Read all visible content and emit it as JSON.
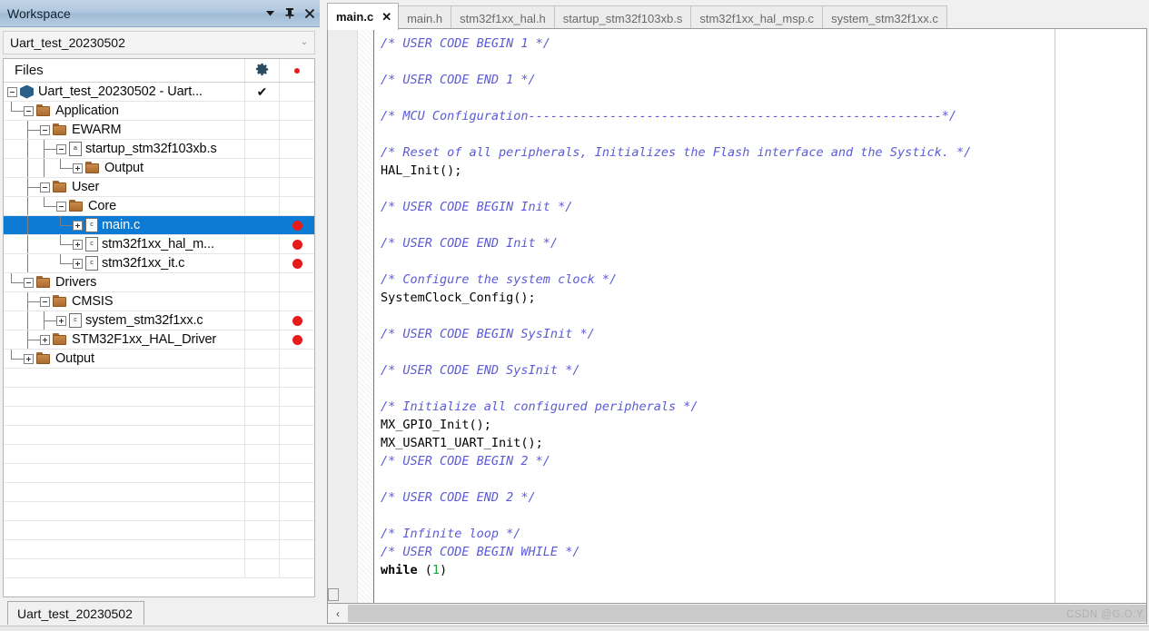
{
  "workspace": {
    "title": "Workspace",
    "title_buttons": [
      {
        "name": "dropdown-arrow",
        "glyph": "▼"
      },
      {
        "name": "pin",
        "glyph": "📌"
      },
      {
        "name": "close",
        "glyph": "✕"
      }
    ],
    "project_dropdown": {
      "value": "Uart_test_20230502",
      "arrow": "⌄"
    },
    "column_headers": {
      "files": "Files",
      "col_b_icon": "gear-icon",
      "col_c_icon": "red-dot-icon"
    },
    "bottom_tab": "Uart_test_20230502",
    "tree": [
      {
        "label": "Uart_test_20230502 - Uart...",
        "depth": 0,
        "icon": "project",
        "toggle": "minus",
        "col_b": "check",
        "col_c": "",
        "selected": false
      },
      {
        "label": "Application",
        "depth": 1,
        "icon": "folder",
        "toggle": "minus",
        "col_b": "",
        "col_c": "",
        "selected": false
      },
      {
        "label": "EWARM",
        "depth": 2,
        "icon": "folder",
        "toggle": "minus",
        "col_b": "",
        "col_c": "",
        "selected": false
      },
      {
        "label": "startup_stm32f103xb.s",
        "depth": 3,
        "icon": "asm-file",
        "toggle": "minus",
        "col_b": "",
        "col_c": "",
        "selected": false
      },
      {
        "label": "Output",
        "depth": 4,
        "icon": "folder",
        "toggle": "plus",
        "col_b": "",
        "col_c": "",
        "selected": false
      },
      {
        "label": "User",
        "depth": 2,
        "icon": "folder",
        "toggle": "minus",
        "col_b": "",
        "col_c": "",
        "selected": false
      },
      {
        "label": "Core",
        "depth": 3,
        "icon": "folder",
        "toggle": "minus",
        "col_b": "",
        "col_c": "",
        "selected": false
      },
      {
        "label": "main.c",
        "depth": 4,
        "icon": "c-file",
        "toggle": "plus",
        "col_b": "",
        "col_c": "dot",
        "selected": true
      },
      {
        "label": "stm32f1xx_hal_m...",
        "depth": 4,
        "icon": "c-file",
        "toggle": "plus",
        "col_b": "",
        "col_c": "dot",
        "selected": false
      },
      {
        "label": "stm32f1xx_it.c",
        "depth": 4,
        "icon": "c-file",
        "toggle": "plus",
        "col_b": "",
        "col_c": "dot",
        "selected": false
      },
      {
        "label": "Drivers",
        "depth": 1,
        "icon": "folder",
        "toggle": "minus",
        "col_b": "",
        "col_c": "",
        "selected": false
      },
      {
        "label": "CMSIS",
        "depth": 2,
        "icon": "folder",
        "toggle": "minus",
        "col_b": "",
        "col_c": "",
        "selected": false
      },
      {
        "label": "system_stm32f1xx.c",
        "depth": 3,
        "icon": "c-file",
        "toggle": "plus",
        "col_b": "",
        "col_c": "dot",
        "selected": false
      },
      {
        "label": "STM32F1xx_HAL_Driver",
        "depth": 2,
        "icon": "folder",
        "toggle": "plus",
        "col_b": "",
        "col_c": "dot",
        "selected": false
      },
      {
        "label": "Output",
        "depth": 1,
        "icon": "folder",
        "toggle": "plus",
        "col_b": "",
        "col_c": "",
        "selected": false
      }
    ]
  },
  "editor": {
    "tabs": [
      {
        "label": "main.c",
        "active": true,
        "close_glyph": "✕"
      },
      {
        "label": "main.h",
        "active": false
      },
      {
        "label": "stm32f1xx_hal.h",
        "active": false
      },
      {
        "label": "startup_stm32f103xb.s",
        "active": false
      },
      {
        "label": "stm32f1xx_hal_msp.c",
        "active": false
      },
      {
        "label": "system_stm32f1xx.c",
        "active": false
      }
    ],
    "hscroll_left_glyph": "‹",
    "code_lines": [
      {
        "segments": [
          {
            "t": "/* USER CODE BEGIN 1 */",
            "k": "cm"
          }
        ]
      },
      {
        "segments": []
      },
      {
        "segments": [
          {
            "t": "/* USER CODE END 1 */",
            "k": "cm"
          }
        ]
      },
      {
        "segments": []
      },
      {
        "segments": [
          {
            "t": "/* MCU Configuration--------------------------------------------------------*/",
            "k": "cm"
          }
        ]
      },
      {
        "segments": []
      },
      {
        "segments": [
          {
            "t": "/* Reset of all peripherals, Initializes the Flash interface and the Systick. */",
            "k": "cm"
          }
        ]
      },
      {
        "segments": [
          {
            "t": "HAL_Init();",
            "k": ""
          }
        ]
      },
      {
        "segments": []
      },
      {
        "segments": [
          {
            "t": "/* USER CODE BEGIN Init */",
            "k": "cm"
          }
        ]
      },
      {
        "segments": []
      },
      {
        "segments": [
          {
            "t": "/* USER CODE END Init */",
            "k": "cm"
          }
        ]
      },
      {
        "segments": []
      },
      {
        "segments": [
          {
            "t": "/* Configure the system clock */",
            "k": "cm"
          }
        ]
      },
      {
        "segments": [
          {
            "t": "SystemClock_Config();",
            "k": ""
          }
        ]
      },
      {
        "segments": []
      },
      {
        "segments": [
          {
            "t": "/* USER CODE BEGIN SysInit */",
            "k": "cm"
          }
        ]
      },
      {
        "segments": []
      },
      {
        "segments": [
          {
            "t": "/* USER CODE END SysInit */",
            "k": "cm"
          }
        ]
      },
      {
        "segments": []
      },
      {
        "segments": [
          {
            "t": "/* Initialize all configured peripherals */",
            "k": "cm"
          }
        ]
      },
      {
        "segments": [
          {
            "t": "MX_GPIO_Init();",
            "k": ""
          }
        ]
      },
      {
        "segments": [
          {
            "t": "MX_USART1_UART_Init();",
            "k": ""
          }
        ]
      },
      {
        "segments": [
          {
            "t": "/* USER CODE BEGIN 2 */",
            "k": "cm"
          }
        ]
      },
      {
        "segments": []
      },
      {
        "segments": [
          {
            "t": "/* USER CODE END 2 */",
            "k": "cm"
          }
        ]
      },
      {
        "segments": []
      },
      {
        "segments": [
          {
            "t": "/* Infinite loop */",
            "k": "cm"
          }
        ]
      },
      {
        "segments": [
          {
            "t": "/* USER CODE BEGIN WHILE */",
            "k": "cm"
          }
        ]
      },
      {
        "segments": [
          {
            "t": "while",
            "k": "kw"
          },
          {
            "t": " (",
            "k": ""
          },
          {
            "t": "1",
            "k": "num"
          },
          {
            "t": ")",
            "k": ""
          }
        ]
      }
    ]
  },
  "watermark": "CSDN @G.O.Y",
  "colors": {
    "selection_blue": "#0d7bd4",
    "comment_purple": "#5b5bd6",
    "marker_red": "#e81b1b",
    "titlebar_blue": "#aec6dd",
    "folder_brown": "#ab6a2e"
  }
}
